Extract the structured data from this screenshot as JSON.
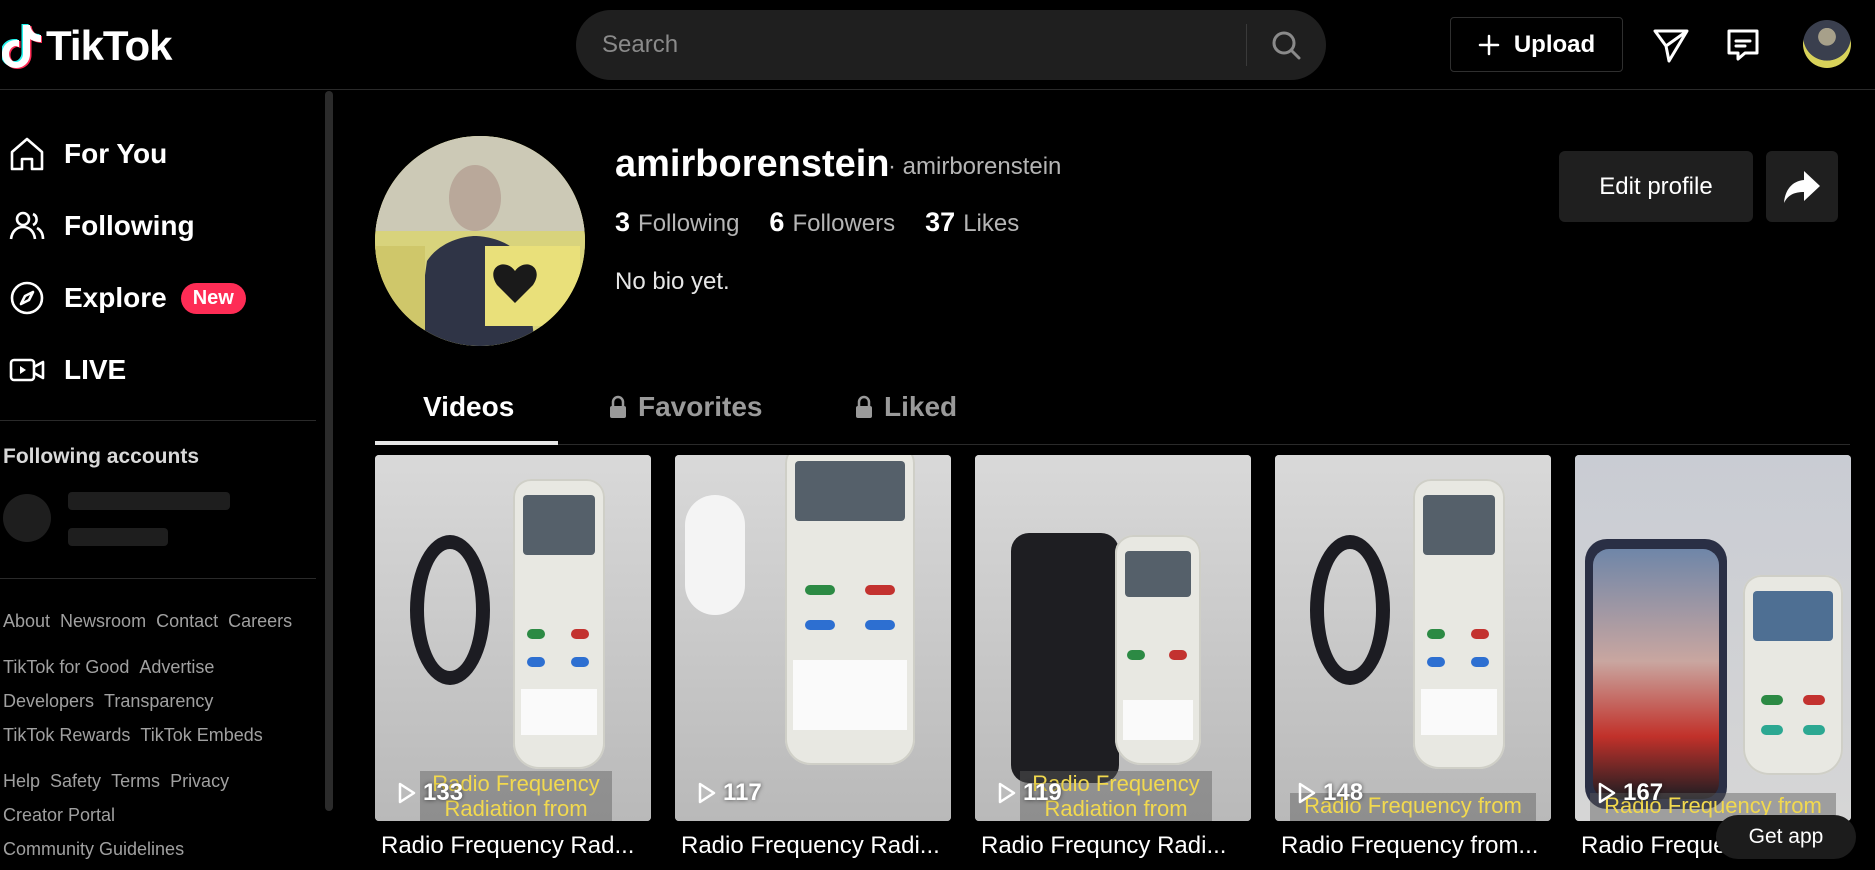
{
  "header": {
    "logo_text": "TikTok",
    "search_placeholder": "Search",
    "upload_label": "Upload"
  },
  "sidebar": {
    "items": [
      {
        "label": "For You",
        "icon": "home-icon"
      },
      {
        "label": "Following",
        "icon": "users-icon"
      },
      {
        "label": "Explore",
        "icon": "compass-icon",
        "badge": "New"
      },
      {
        "label": "LIVE",
        "icon": "live-camera-icon"
      }
    ],
    "following_title": "Following accounts",
    "footer": [
      [
        "About",
        "Newsroom",
        "Contact",
        "Careers"
      ],
      [
        "TikTok for Good",
        "Advertise"
      ],
      [
        "Developers",
        "Transparency"
      ],
      [
        "TikTok Rewards",
        "TikTok Embeds"
      ],
      [
        "Help",
        "Safety",
        "Terms",
        "Privacy"
      ],
      [
        "Creator Portal"
      ],
      [
        "Community Guidelines"
      ]
    ]
  },
  "profile": {
    "username": "amirborenstein",
    "nickname": "· amirborenstein",
    "stats": [
      {
        "num": "3",
        "label": "Following"
      },
      {
        "num": "6",
        "label": "Followers"
      },
      {
        "num": "37",
        "label": "Likes"
      }
    ],
    "bio": "No bio yet.",
    "edit_label": "Edit profile"
  },
  "tabs": [
    {
      "label": "Videos",
      "locked": false
    },
    {
      "label": "Favorites",
      "locked": true
    },
    {
      "label": "Liked",
      "locked": true
    }
  ],
  "videos": [
    {
      "views": "133",
      "title": "Radio Frequency Rad...",
      "overlay": "Radio Frequency Radiation  from"
    },
    {
      "views": "117",
      "title": "Radio Frequency Radi...",
      "overlay": ""
    },
    {
      "views": "119",
      "title": "Radio Frequncy Radi...",
      "overlay": "Radio Frequency Radiation from"
    },
    {
      "views": "148",
      "title": "Radio Frequency from...",
      "overlay": "Radio Frequency  from"
    },
    {
      "views": "167",
      "title": "Radio Frequency...",
      "overlay": "Radio Frequency  from"
    }
  ],
  "get_app_label": "Get app",
  "colors": {
    "accent": "#fe2c55",
    "background": "#000000",
    "surface": "#1f1f1f"
  }
}
